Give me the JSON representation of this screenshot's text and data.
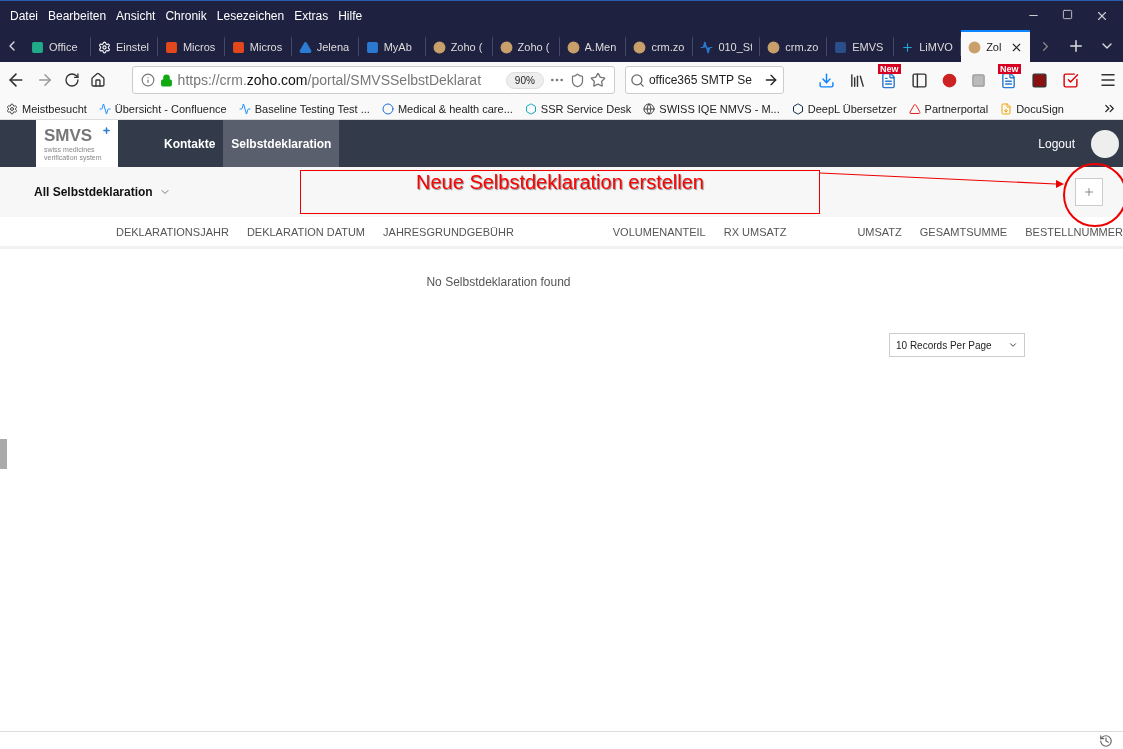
{
  "menu": [
    "Datei",
    "Bearbeiten",
    "Ansicht",
    "Chronik",
    "Lesezeichen",
    "Extras",
    "Hilfe"
  ],
  "tabs": [
    {
      "title": "Office",
      "selected": false
    },
    {
      "title": "Einstel",
      "selected": false
    },
    {
      "title": "Micros",
      "selected": false
    },
    {
      "title": "Micros",
      "selected": false
    },
    {
      "title": "Jelena",
      "selected": false
    },
    {
      "title": "MyAb",
      "selected": false
    },
    {
      "title": "Zoho (",
      "selected": false
    },
    {
      "title": "Zoho (",
      "selected": false
    },
    {
      "title": "A.Men",
      "selected": false
    },
    {
      "title": "crm.zo",
      "selected": false
    },
    {
      "title": "010_St",
      "selected": false
    },
    {
      "title": "crm.zo",
      "selected": false
    },
    {
      "title": "EMVS",
      "selected": false
    },
    {
      "title": "LiMVO",
      "selected": false
    },
    {
      "title": "Zol",
      "selected": true
    }
  ],
  "address": {
    "prefix": "https://crm.",
    "domain": "zoho.com",
    "path": "/portal/SMVSSelbstDeklarat",
    "zoom": "90%"
  },
  "search": {
    "value": "office365 SMTP Se"
  },
  "badges": [
    "New",
    "New"
  ],
  "bookmarks": [
    "Meistbesucht",
    "Übersicht - Confluence",
    "Baseline Testing Test ...",
    "Medical & health care...",
    "SSR Service Desk",
    "SWISS IQE NMVS - M...",
    "DeepL Übersetzer",
    "Partnerportal",
    "DocuSign"
  ],
  "app": {
    "logo": "SMVS",
    "logo_sub": "swiss medicines verification system",
    "nav": [
      {
        "label": "Kontakte",
        "selected": false
      },
      {
        "label": "Selbstdeklaration",
        "selected": true
      }
    ],
    "logout": "Logout"
  },
  "view": {
    "label": "All Selbstdeklaration"
  },
  "annotation": {
    "text": "Neue Selbstdeklaration erstellen"
  },
  "columns": [
    "DEKLARATIONSJAHR",
    "DEKLARATION DATUM",
    "JAHRESGRUNDGEBÜHR",
    "",
    "VOLUMENANTEIL",
    "RX UMSATZ",
    "",
    "UMSATZ",
    "GESAMTSUMME",
    "BESTELLNUMMER"
  ],
  "empty": "No Selbstdeklaration found",
  "pager": {
    "value": "10 Records Per Page"
  }
}
